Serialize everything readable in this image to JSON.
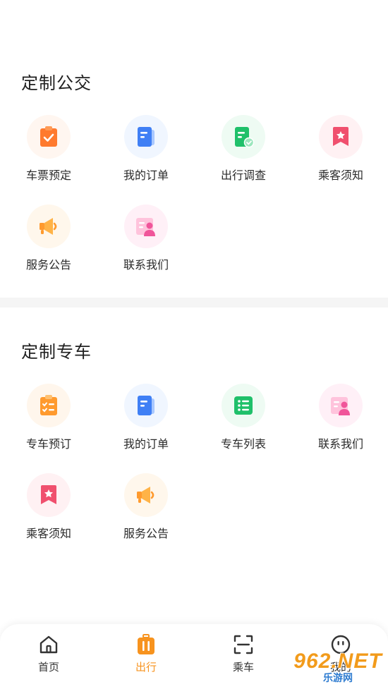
{
  "bus": {
    "title": "定制公交",
    "items": [
      {
        "label": "车票预定"
      },
      {
        "label": "我的订单"
      },
      {
        "label": "出行调查"
      },
      {
        "label": "乘客须知"
      },
      {
        "label": "服务公告"
      },
      {
        "label": "联系我们"
      }
    ]
  },
  "car": {
    "title": "定制专车",
    "items": [
      {
        "label": "专车预订"
      },
      {
        "label": "我的订单"
      },
      {
        "label": "专车列表"
      },
      {
        "label": "联系我们"
      },
      {
        "label": "乘客须知"
      },
      {
        "label": "服务公告"
      }
    ]
  },
  "tabbar": {
    "tabs": [
      {
        "label": "首页"
      },
      {
        "label": "出行"
      },
      {
        "label": "乘车"
      },
      {
        "label": "我的"
      }
    ],
    "active": "出行"
  },
  "watermark": {
    "top": "962.NET",
    "bottom": "乐游网"
  },
  "colors": {
    "accent": "#f7931e",
    "orange_icon": "#ff7a2e",
    "blue_icon": "#3f7ff5",
    "green_icon": "#1fc06a",
    "red_icon": "#f0506e",
    "pink_icon": "#f0559a"
  }
}
